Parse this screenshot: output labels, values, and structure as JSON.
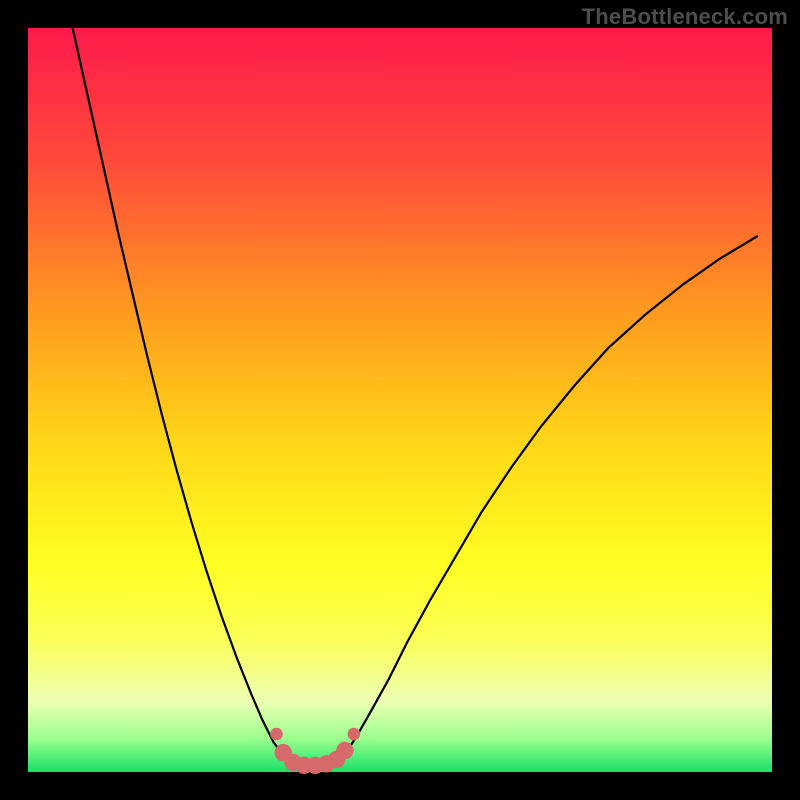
{
  "watermark": "TheBottleneck.com",
  "chart_data": {
    "type": "line",
    "title": "",
    "xlabel": "",
    "ylabel": "",
    "xlim": [
      0,
      100
    ],
    "ylim": [
      0,
      100
    ],
    "grid": false,
    "legend": false,
    "background_gradient": {
      "stops": [
        {
          "pos": 0.0,
          "color": "#ff1a4b"
        },
        {
          "pos": 0.18,
          "color": "#ff4a3a"
        },
        {
          "pos": 0.38,
          "color": "#ff9a1f"
        },
        {
          "pos": 0.55,
          "color": "#ffd417"
        },
        {
          "pos": 0.72,
          "color": "#ffff22"
        },
        {
          "pos": 0.82,
          "color": "#fbff55"
        },
        {
          "pos": 0.905,
          "color": "#ecffb3"
        },
        {
          "pos": 0.955,
          "color": "#9cff8e"
        },
        {
          "pos": 1.0,
          "color": "#18e06a"
        }
      ]
    },
    "series": [
      {
        "name": "bottleneck-curve-left",
        "stroke": "#000000",
        "stroke_width": 2.2,
        "x": [
          6.0,
          8.0,
          10.0,
          12.0,
          14.0,
          16.0,
          18.0,
          20.0,
          22.0,
          24.0,
          26.0,
          28.0,
          30.0,
          31.5,
          33.0,
          34.3
        ],
        "y": [
          100.0,
          91.0,
          82.0,
          73.0,
          64.5,
          56.0,
          48.0,
          40.5,
          33.5,
          27.0,
          21.0,
          15.5,
          10.5,
          7.0,
          4.0,
          2.3
        ]
      },
      {
        "name": "bottleneck-curve-right",
        "stroke": "#000000",
        "stroke_width": 2.2,
        "x": [
          42.5,
          44.0,
          46.0,
          48.5,
          51.0,
          54.0,
          57.5,
          61.0,
          65.0,
          69.0,
          73.5,
          78.0,
          83.0,
          88.0,
          93.0,
          98.0
        ],
        "y": [
          2.3,
          4.5,
          8.0,
          12.5,
          17.5,
          23.0,
          29.0,
          35.0,
          41.0,
          46.5,
          52.0,
          57.0,
          61.5,
          65.5,
          69.0,
          72.0
        ]
      }
    ],
    "markers": {
      "name": "valley-markers",
      "color": "#d66a6a",
      "radius_large": 8.7,
      "radius_small": 6.3,
      "points": [
        {
          "x": 33.4,
          "y": 5.1,
          "r": "small"
        },
        {
          "x": 34.3,
          "y": 2.6,
          "r": "large"
        },
        {
          "x": 35.6,
          "y": 1.3,
          "r": "large"
        },
        {
          "x": 37.1,
          "y": 0.9,
          "r": "large"
        },
        {
          "x": 38.6,
          "y": 0.9,
          "r": "large"
        },
        {
          "x": 40.1,
          "y": 1.1,
          "r": "large"
        },
        {
          "x": 41.5,
          "y": 1.7,
          "r": "large"
        },
        {
          "x": 42.6,
          "y": 2.9,
          "r": "large"
        },
        {
          "x": 43.8,
          "y": 5.1,
          "r": "small"
        }
      ]
    }
  }
}
